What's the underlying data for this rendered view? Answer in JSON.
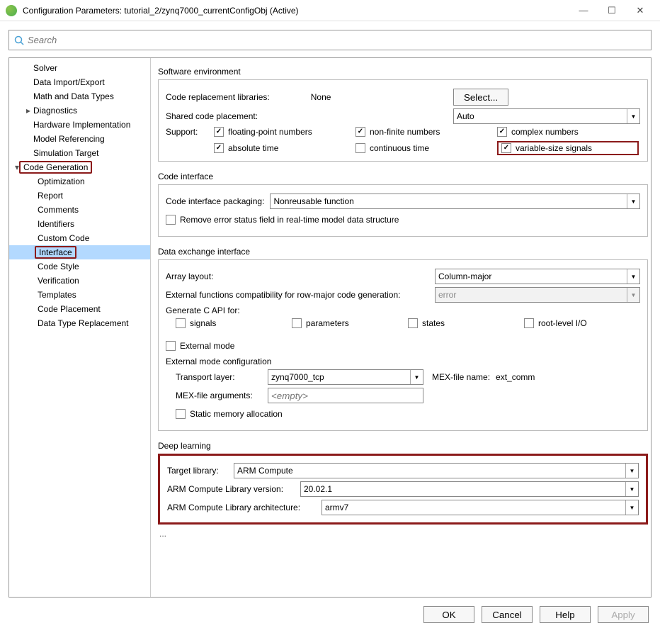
{
  "window": {
    "title": "Configuration Parameters: tutorial_2/zynq7000_currentConfigObj (Active)"
  },
  "search": {
    "placeholder": "Search"
  },
  "tree": {
    "items": [
      {
        "label": "Solver",
        "depth": 1
      },
      {
        "label": "Data Import/Export",
        "depth": 1
      },
      {
        "label": "Math and Data Types",
        "depth": 1
      },
      {
        "label": "Diagnostics",
        "depth": 1,
        "arrow": "▸"
      },
      {
        "label": "Hardware Implementation",
        "depth": 1
      },
      {
        "label": "Model Referencing",
        "depth": 1
      },
      {
        "label": "Simulation Target",
        "depth": 1
      },
      {
        "label": "Code Generation",
        "depth": 0,
        "arrow": "▾",
        "highlight": true
      },
      {
        "label": "Optimization",
        "depth": 2
      },
      {
        "label": "Report",
        "depth": 2
      },
      {
        "label": "Comments",
        "depth": 2
      },
      {
        "label": "Identifiers",
        "depth": 2
      },
      {
        "label": "Custom Code",
        "depth": 2
      },
      {
        "label": "Interface",
        "depth": 2,
        "selected": true,
        "highlight": true
      },
      {
        "label": "Code Style",
        "depth": 2
      },
      {
        "label": "Verification",
        "depth": 2
      },
      {
        "label": "Templates",
        "depth": 2
      },
      {
        "label": "Code Placement",
        "depth": 2
      },
      {
        "label": "Data Type Replacement",
        "depth": 2
      }
    ]
  },
  "soft_env": {
    "title": "Software environment",
    "code_repl_label": "Code replacement libraries:",
    "code_repl_value": "None",
    "select_btn": "Select...",
    "shared_label": "Shared code placement:",
    "shared_value": "Auto",
    "support_label": "Support:",
    "options": {
      "float": "floating-point numbers",
      "nonfinite": "non-finite numbers",
      "complex": "complex numbers",
      "abstime": "absolute time",
      "contime": "continuous time",
      "varsize": "variable-size signals"
    }
  },
  "code_if": {
    "title": "Code interface",
    "pkg_label": "Code interface packaging:",
    "pkg_value": "Nonreusable function",
    "remove_err": "Remove error status field in real-time model data structure"
  },
  "data_ex": {
    "title": "Data exchange interface",
    "array_label": "Array layout:",
    "array_value": "Column-major",
    "extfn_label": "External functions compatibility for row-major code generation:",
    "extfn_value": "error",
    "genc_label": "Generate C API for:",
    "capi": {
      "signals": "signals",
      "params": "parameters",
      "states": "states",
      "root": "root-level I/O"
    },
    "extmode": "External mode",
    "extmode_cfg": "External mode configuration",
    "transport_label": "Transport layer:",
    "transport_value": "zynq7000_tcp",
    "mexname_label": "MEX-file name:",
    "mexname_value": "ext_comm",
    "mexargs_label": "MEX-file arguments:",
    "mexargs_placeholder": "<empty>",
    "static_alloc": "Static memory allocation"
  },
  "deep": {
    "title": "Deep learning",
    "target_label": "Target library:",
    "target_value": "ARM Compute",
    "ver_label": "ARM Compute Library version:",
    "ver_value": "20.02.1",
    "arch_label": "ARM Compute Library architecture:",
    "arch_value": "armv7"
  },
  "ellipsis": "...",
  "footer": {
    "ok": "OK",
    "cancel": "Cancel",
    "help": "Help",
    "apply": "Apply"
  }
}
